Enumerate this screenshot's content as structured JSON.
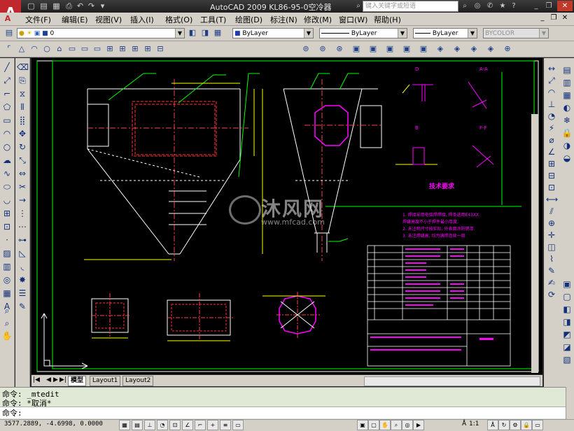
{
  "titlebar": {
    "app_title": "AutoCAD 2009  KL86-95-0空冷器",
    "search_placeholder": "键入关键字或短语"
  },
  "menus": [
    "文件(F)",
    "编辑(E)",
    "视图(V)",
    "插入(I)",
    "格式(O)",
    "工具(T)",
    "绘图(D)",
    "标注(N)",
    "修改(M)",
    "窗口(W)",
    "帮助(H)"
  ],
  "layers_toolbar": {
    "layer_value": "0",
    "color_value": "ByLayer",
    "linetype_value": "ByLayer",
    "lineweight_value": "ByLayer",
    "plotstyle_value": "BYCOLOR"
  },
  "drawing": {
    "watermark_name": "沐风网",
    "watermark_url": "www.mfcad.com",
    "tech_title": "技术要求",
    "tech_notes": [
      "1. 焊接采用电弧焊焊接, 焊条选用E43XX.",
      "   焊缝高度不小于焊件最小厚度.",
      "2. 未注明尺寸按实际, 外表面涂防锈漆.",
      "3. 未注焊缝高, 均为满焊连续一周."
    ],
    "section_labels": [
      "D",
      "B",
      "C",
      "A-A",
      "F-F"
    ],
    "colors": {
      "background": "#000000",
      "outline": "#ffffff",
      "hidden": "#ff3333",
      "center": "#ff4444",
      "dimension": "#ffff00",
      "annotation": "#ff00ff",
      "leader": "#00ff00",
      "frame": "#ffffff",
      "section": "#ff00ff"
    }
  },
  "tabs": [
    "模型",
    "Layout1",
    "Layout2"
  ],
  "command": {
    "line1": "命令: _mtedit",
    "line2": "命令: *取消*",
    "prompt": "命令:"
  },
  "status": {
    "coords": "3577.2889, -4.6998, 0.0000",
    "scale": "1:1"
  }
}
